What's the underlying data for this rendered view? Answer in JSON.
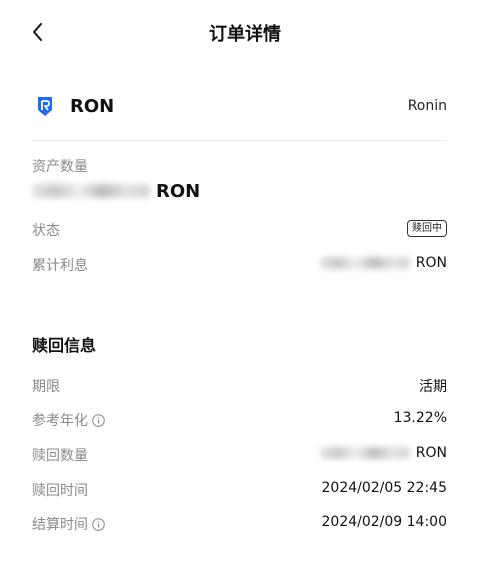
{
  "header": {
    "title": "订单详情"
  },
  "asset": {
    "symbol": "RON",
    "network": "Ronin"
  },
  "summary": {
    "amount_label": "资产数量",
    "amount_unit": "RON",
    "status_label": "状态",
    "status_value": "赎回中",
    "interest_label": "累计利息",
    "interest_unit": "RON"
  },
  "redeem": {
    "section_title": "赎回信息",
    "term_label": "期限",
    "term_value": "活期",
    "apr_label": "参考年化",
    "apr_value": "13.22%",
    "qty_label": "赎回数量",
    "qty_unit": "RON",
    "time_label": "赎回时间",
    "time_value": "2024/02/05 22:45",
    "settle_label": "结算时间",
    "settle_value": "2024/02/09 14:00"
  },
  "colors": {
    "accent": "#1c6bf0",
    "label": "#8a8a8a",
    "text": "#111111"
  }
}
